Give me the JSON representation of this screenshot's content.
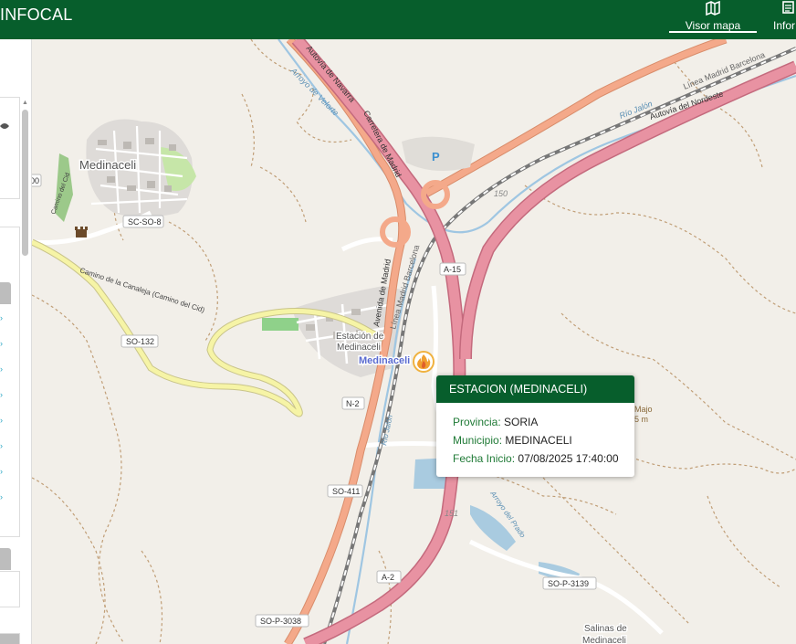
{
  "header": {
    "brand": "INFOCAL",
    "nav": [
      {
        "label": "Visor mapa",
        "icon": "map-icon",
        "active": true
      },
      {
        "label": "Infor",
        "icon": "document-icon",
        "active": false
      }
    ],
    "color": "#075e2c"
  },
  "sidebar": {
    "visible_tab_text": "00"
  },
  "map": {
    "labels": {
      "town_medinaceli": "Medinaceli",
      "estacion": "Estación de",
      "estacion2": "Medinaceli",
      "poi_medinaceli": "Medinaceli",
      "salinas": "Salinas de",
      "salinas2": "Medinaceli",
      "parking": "P",
      "majo": "Majo",
      "majo_elev": "5 m",
      "elev_150": "150",
      "elev_151": "151"
    },
    "road_shields": {
      "sc_so_8": "SC-SO-8",
      "so_132": "SO-132",
      "a15": "A-15",
      "n2": "N-2",
      "so411": "SO-411",
      "a2": "A-2",
      "sop3139": "SO-P-3139",
      "sop3038": "SO-P-3038"
    },
    "road_names": {
      "autovia_navarra": "Autovía de Navarra",
      "carretera_madrid": "Carretera de Madrid",
      "arroyo_velorte": "Arroyo de Velorte",
      "rio_jalon": "Río Jalón",
      "linea_madrid_barcelona": "Línea Madrid Barcelona",
      "autovia_nordeste": "Autovía del Nordeste",
      "linea_madrid_barcelona2": "Línea Madrid Barcelona",
      "avenida_madrid": "Avenida de Madrid",
      "camino_canaleja": "Camino de la Canaleja (Camino del Cid)",
      "rio_jalon2": "Río Jalón",
      "arroyo_prado": "Arroyo del Prado",
      "camino_cid_small": "Camino del Cid"
    }
  },
  "popup": {
    "title": "ESTACION (MEDINACELI)",
    "provincia_label": "Provincia:",
    "provincia_value": "SORIA",
    "municipio_label": "Municipio:",
    "municipio_value": "MEDINACELI",
    "fecha_label": "Fecha Inicio:",
    "fecha_value": "07/08/2025 17:40:00"
  },
  "marker": {
    "icon": "fire-icon"
  }
}
